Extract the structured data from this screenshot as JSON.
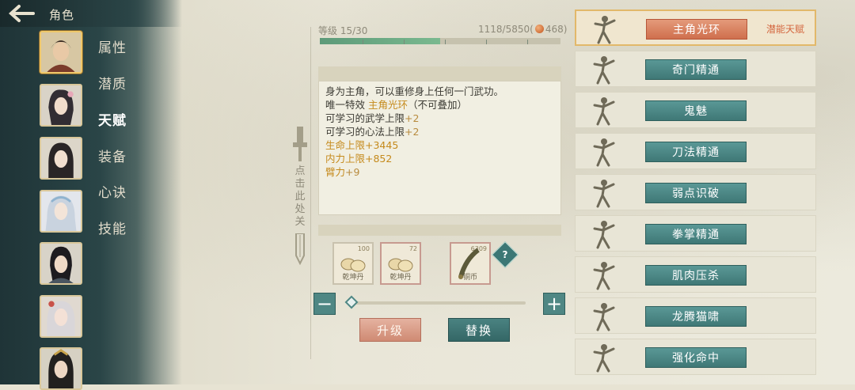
{
  "header": {
    "title": "角色"
  },
  "nav": {
    "tabs": [
      {
        "label": "属性",
        "active": false
      },
      {
        "label": "潜质",
        "active": false
      },
      {
        "label": "天赋",
        "active": true
      },
      {
        "label": "装备",
        "active": false
      },
      {
        "label": "心诀",
        "active": false
      },
      {
        "label": "技能",
        "active": false
      }
    ]
  },
  "level": {
    "label": "等级",
    "value": "15/30",
    "exp": "1118/5850(",
    "coins": "468)",
    "progress": 0.5
  },
  "description": {
    "lines": [
      {
        "text": "身为主角，可以重修身上任何一门武功。"
      },
      {
        "pre": "唯一特效 ",
        "hl": "主角光环",
        "post": "（不可叠加）"
      },
      {
        "pre": "可学习的武学上限",
        "num": "+2"
      },
      {
        "pre": "可学习的心法上限",
        "num": "+2"
      },
      {
        "hl": "生命上限+3445"
      },
      {
        "hl": "内力上限+852"
      },
      {
        "pre": "臂力",
        "num": "+9"
      }
    ]
  },
  "close_hint": "点击此处关",
  "items": [
    {
      "count": "100",
      "name": "乾坤丹"
    },
    {
      "count": "72",
      "name": "乾坤丹"
    },
    {
      "count": "6309",
      "name": "铜币"
    }
  ],
  "help": "?",
  "buttons": {
    "minus": "−",
    "plus": "+",
    "upgrade": "升级",
    "replace": "替换"
  },
  "slider": {
    "value": 0
  },
  "talents": [
    {
      "name": "主角光环",
      "tag": "潜能天赋",
      "selected": true
    },
    {
      "name": "奇门精通",
      "tag": "",
      "selected": false
    },
    {
      "name": "鬼魅",
      "tag": "",
      "selected": false
    },
    {
      "name": "刀法精通",
      "tag": "",
      "selected": false
    },
    {
      "name": "弱点识破",
      "tag": "",
      "selected": false
    },
    {
      "name": "拳掌精通",
      "tag": "",
      "selected": false
    },
    {
      "name": "肌肉压杀",
      "tag": "",
      "selected": false
    },
    {
      "name": "龙腾猫啸",
      "tag": "",
      "selected": false
    },
    {
      "name": "强化命中",
      "tag": "",
      "selected": false
    }
  ],
  "colors": {
    "accent_teal": "#3f7876",
    "accent_orange": "#cf6f4d",
    "highlight_text": "#c58a1c"
  }
}
